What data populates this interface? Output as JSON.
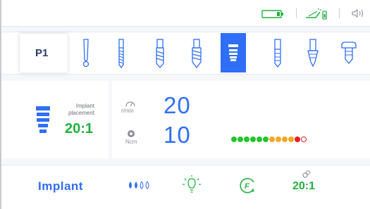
{
  "program": {
    "label": "P1"
  },
  "tools": [
    {
      "name": "probe"
    },
    {
      "name": "pilot-drill"
    },
    {
      "name": "twist-drill-medium"
    },
    {
      "name": "twist-drill-large"
    },
    {
      "name": "implant",
      "active": true
    },
    {
      "name": "tap"
    },
    {
      "name": "countersink"
    },
    {
      "name": "abutment"
    }
  ],
  "status": {
    "battery_icon": "battery-icon",
    "spray_icon": "spray-bottle-icon",
    "speaker_icon": "speaker-icon"
  },
  "implant_placement": {
    "label_line1": "Implant",
    "label_line2": "placement",
    "ratio": "20:1"
  },
  "speed": {
    "value": "20",
    "unit": "r/min"
  },
  "torque": {
    "value": "10",
    "unit": "Ncm",
    "level_dots": [
      "#22c52a",
      "#22c52a",
      "#22c52a",
      "#22c52a",
      "#22c52a",
      "#22c52a",
      "#f5a623",
      "#f5a623",
      "#f5a623",
      "#f5a623",
      "#e81e1e",
      "empty"
    ]
  },
  "bottom": {
    "mode_label": "Implant",
    "coolant_icon": "water-drops-icon",
    "light_icon": "light-bulb-icon",
    "direction_icon": "forward-rotation-icon",
    "direction_letter": "F",
    "gear_ratio": "20:1"
  },
  "colors": {
    "accent": "#2f6ef5",
    "green": "#22b23e",
    "text_dark": "#2a3a66"
  }
}
